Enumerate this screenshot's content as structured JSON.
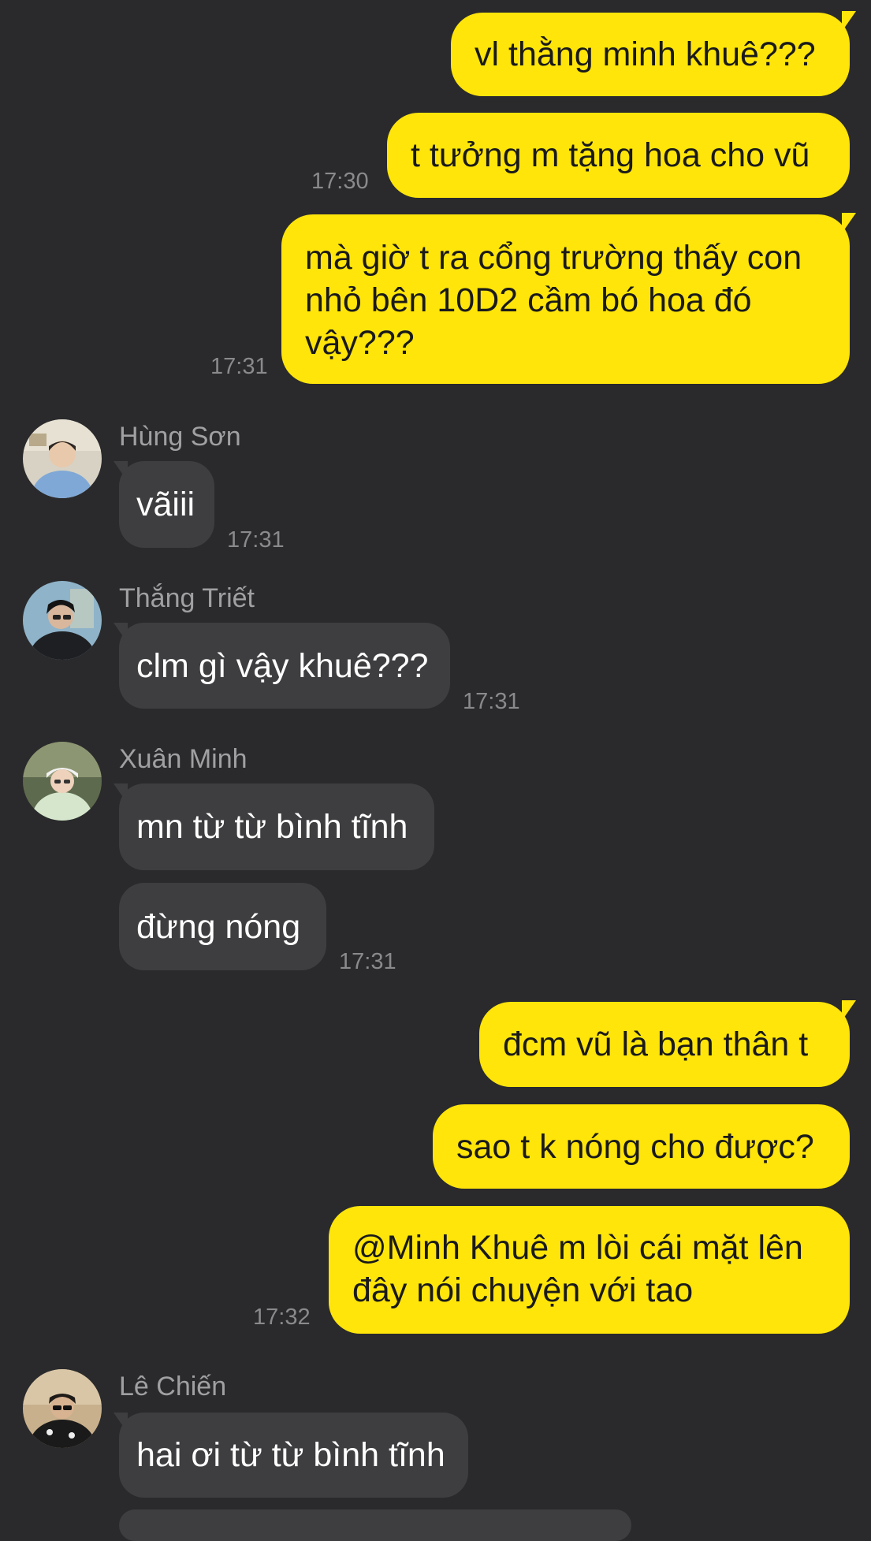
{
  "messages": [
    {
      "id": "m1",
      "text": "vl thằng minh khuê???"
    },
    {
      "id": "m2",
      "text": "t tưởng m tặng hoa cho vũ",
      "time": "17:30"
    },
    {
      "id": "m3",
      "text": "mà giờ t ra cổng trường thấy con nhỏ bên 10D2 cầm bó hoa đó vậy???",
      "time": "17:31"
    },
    {
      "id": "m4",
      "sender": "Hùng Sơn",
      "text": "vãiii",
      "time": "17:31"
    },
    {
      "id": "m5",
      "sender": "Thắng Triết",
      "text": "clm gì vậy khuê???",
      "time": "17:31"
    },
    {
      "id": "m6",
      "sender": "Xuân Minh",
      "text": "mn từ từ bình tĩnh"
    },
    {
      "id": "m7",
      "text": "đừng nóng",
      "time": "17:31"
    },
    {
      "id": "m8",
      "text": "đcm vũ là bạn thân t"
    },
    {
      "id": "m9",
      "text": "sao t k nóng cho được?"
    },
    {
      "id": "m10",
      "text": "@Minh Khuê m lòi cái mặt lên đây nói chuyện với tao",
      "time": "17:32"
    },
    {
      "id": "m11",
      "sender": "Lê Chiến",
      "text": "hai ơi từ từ bình tĩnh"
    }
  ],
  "avatars": {
    "hung_son": "avatar-hung-son",
    "thang_triet": "avatar-thang-triet",
    "xuan_minh": "avatar-xuan-minh",
    "le_chien": "avatar-le-chien"
  },
  "colors": {
    "background": "#2a2a2c",
    "outgoing_bubble": "#ffe50a",
    "incoming_bubble": "#3e3e40",
    "timestamp": "#8a8a8d"
  }
}
